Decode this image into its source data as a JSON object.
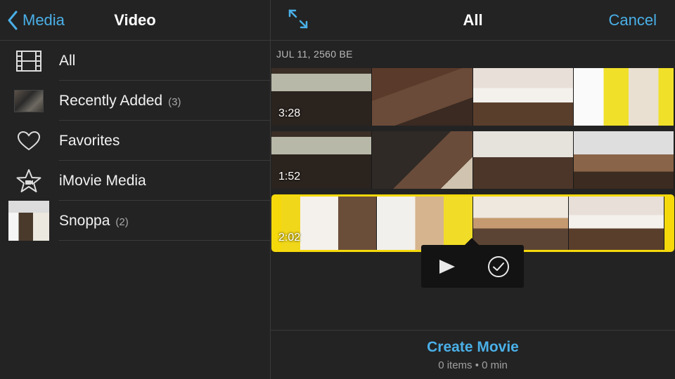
{
  "left_header": {
    "back_label": "Media",
    "title": "Video"
  },
  "library": [
    {
      "label": "All",
      "count": ""
    },
    {
      "label": "Recently Added",
      "count": "(3)"
    },
    {
      "label": "Favorites",
      "count": ""
    },
    {
      "label": "iMovie Media",
      "count": ""
    },
    {
      "label": "Snoppa",
      "count": "(2)"
    }
  ],
  "right_header": {
    "title": "All",
    "cancel_label": "Cancel"
  },
  "date_label": "JUL 11, 2560 BE",
  "clips": [
    {
      "duration": "3:28",
      "selected": false
    },
    {
      "duration": "1:52",
      "selected": false
    },
    {
      "duration": "2:02",
      "selected": true
    }
  ],
  "footer": {
    "create_label": "Create Movie",
    "summary": "0 items • 0 min"
  },
  "colors": {
    "accent": "#4ab0e8",
    "selection": "#f5d90b",
    "background": "#232323"
  }
}
